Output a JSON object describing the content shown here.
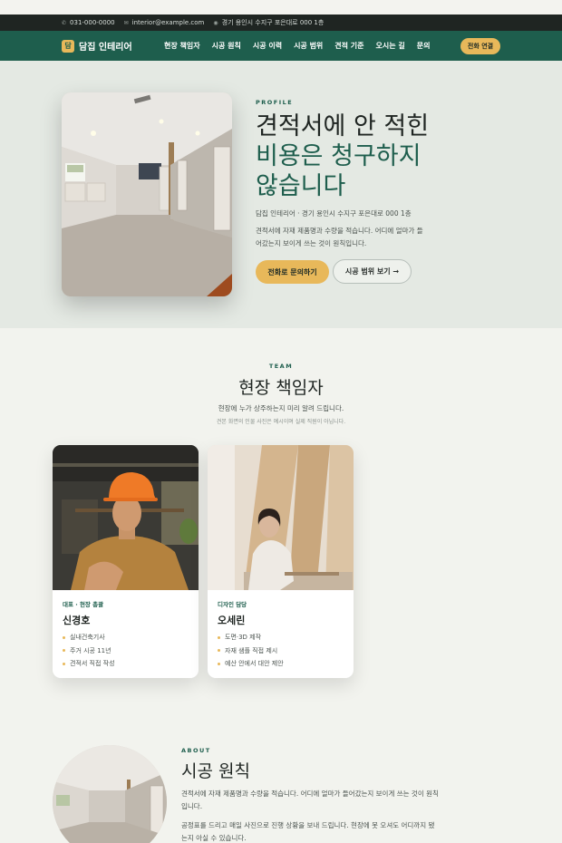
{
  "infobar": {
    "phone": "031-000-0000",
    "email": "interior@example.com",
    "address": "경기 용인시 수지구 포은대로 000 1층"
  },
  "nav": {
    "logo_mark": "담",
    "logo_text": "담집 인테리어",
    "menu": [
      "현장 책임자",
      "시공 원칙",
      "시공 이력",
      "시공 범위",
      "견적 기준",
      "오시는 길",
      "문의"
    ],
    "cta": "전화 연결"
  },
  "hero": {
    "eyebrow": "PROFILE",
    "title_line1": "견적서에 안 적힌",
    "title_line2": "비용은 청구하지",
    "title_line3": "않습니다",
    "address": "담집 인테리어 · 경기 용인시 수지구 포은대로 000 1층",
    "desc": "견적서에 자재 제품명과 수량을 적습니다. 어디에 얼마가 들어갔는지 보이게 쓰는 것이 원칙입니다.",
    "btn_primary": "전화로 문의하기",
    "btn_outline": "시공 범위 보기 →"
  },
  "team": {
    "eyebrow": "TEAM",
    "title": "현장 책임자",
    "subtitle": "현장에 누가 상주하는지 미리 알려 드립니다.",
    "note": "견본 화면의 인물 사진은 예시이며 실제 직원이 아닙니다.",
    "members": [
      {
        "role": "대표 · 현장 총괄",
        "name": "신경호",
        "items": [
          "실내건축기사",
          "주거 시공 11년",
          "견적서 직접 작성"
        ]
      },
      {
        "role": "디자인 담당",
        "name": "오세린",
        "items": [
          "도면·3D 제작",
          "자재 샘플 직접 제시",
          "예산 안에서 대안 제안"
        ]
      }
    ]
  },
  "about": {
    "eyebrow": "ABOUT",
    "title": "시공 원칙",
    "p1": "견적서에 자재 제품명과 수량을 적습니다. 어디에 얼마가 들어갔는지 보이게 쓰는 것이 원칙입니다.",
    "p2": "공정표를 드리고 매일 사진으로 진행 상황을 보내 드립니다. 현장에 못 오셔도 어디까지 됐는지 아실 수 있습니다."
  },
  "colors": {
    "brand": "#1e5e4d",
    "accent": "#e8b85a",
    "dark": "#1f2522"
  }
}
